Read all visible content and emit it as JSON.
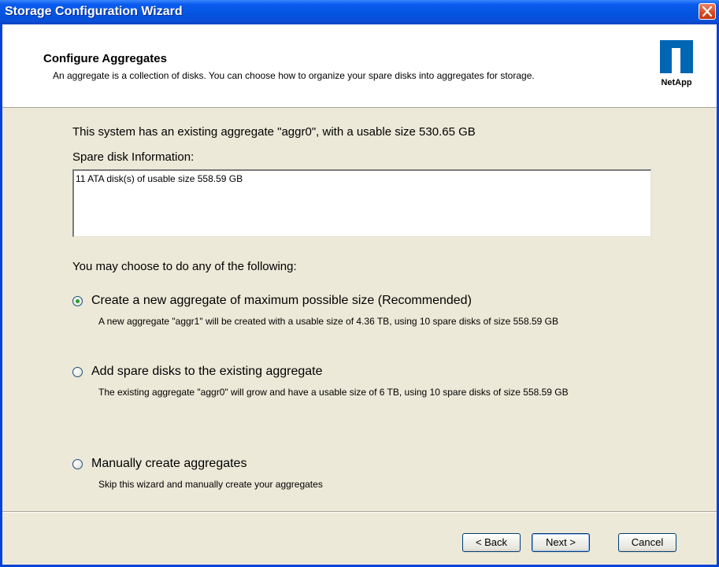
{
  "window": {
    "title": "Storage Configuration Wizard"
  },
  "header": {
    "title": "Configure Aggregates",
    "description": "An aggregate is a collection of disks.  You can choose how to organize your spare disks into aggregates for storage.",
    "logo_text": "NetApp"
  },
  "main": {
    "existing_text": "This system has an existing aggregate \"aggr0\", with a usable size 530.65 GB",
    "spare_label": "Spare disk Information:",
    "spare_info": "11 ATA disk(s) of usable size 558.59 GB",
    "choose_text": "You may choose to do any of the following:",
    "options": [
      {
        "label": "Create a new aggregate of maximum possible size (Recommended)",
        "description": "A new aggregate \"aggr1\" will be created with a usable size of 4.36 TB, using 10 spare disks of size 558.59 GB",
        "selected": true
      },
      {
        "label": "Add spare disks to the existing aggregate",
        "description": "The existing aggregate \"aggr0\" will grow and have a usable size of 6 TB, using 10 spare disks of size 558.59 GB",
        "selected": false
      },
      {
        "label": "Manually create aggregates",
        "description": "Skip this wizard and manually create your aggregates",
        "selected": false
      }
    ]
  },
  "footer": {
    "back_label": "< Back",
    "next_label": "Next >",
    "cancel_label": "Cancel"
  },
  "colors": {
    "titlebar": "#0453e0",
    "dialog_bg": "#ece9d8",
    "logo": "#0066b3",
    "radio_selected": "#21a121"
  }
}
